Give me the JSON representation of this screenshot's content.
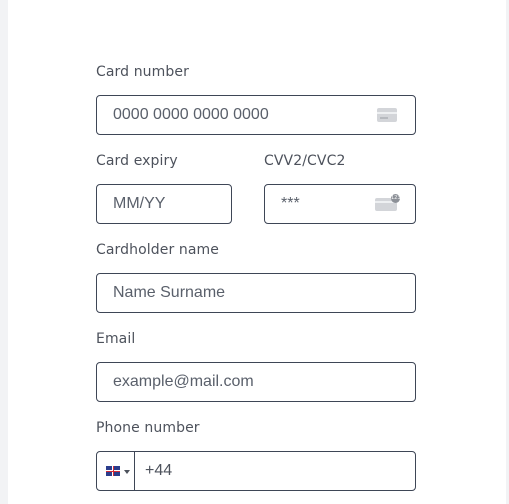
{
  "form": {
    "card_number": {
      "label": "Card number",
      "placeholder": "0000 0000 0000 0000",
      "icon": "credit-card-icon"
    },
    "card_expiry": {
      "label": "Card expiry",
      "placeholder": "MM/YY"
    },
    "cvv": {
      "label": "CVV2/CVC2",
      "placeholder": "***",
      "icon": "cvv-card-icon"
    },
    "cardholder": {
      "label": "Cardholder name",
      "placeholder": "Name Surname"
    },
    "email": {
      "label": "Email",
      "placeholder": "example@mail.com"
    },
    "phone": {
      "label": "Phone number",
      "value": "+44",
      "country_flag": "uk-flag-icon"
    }
  }
}
